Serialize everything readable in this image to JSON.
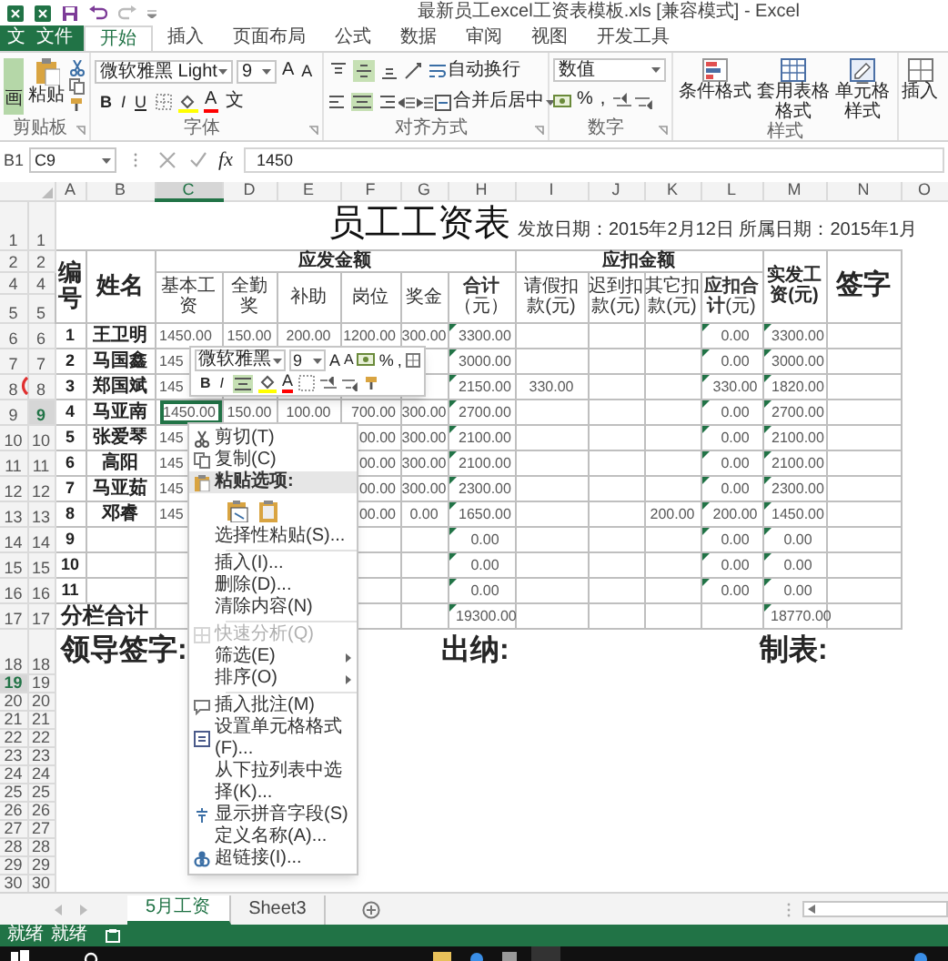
{
  "title_bar": {
    "title": "最新员工excel工资表模板.xls [兼容模式] - Excel"
  },
  "file_area": {
    "app_label": "文",
    "file_tab": "文件"
  },
  "tabs": [
    {
      "label": "开始",
      "selected": true
    },
    {
      "label": "插入",
      "selected": false
    },
    {
      "label": "页面布局",
      "selected": false
    },
    {
      "label": "公式",
      "selected": false
    },
    {
      "label": "数据",
      "selected": false
    },
    {
      "label": "审阅",
      "selected": false
    },
    {
      "label": "视图",
      "selected": false
    },
    {
      "label": "开发工具",
      "selected": false
    }
  ],
  "ribbon": {
    "clipboard": {
      "side_button": {
        "label": "画",
        "selected": true
      },
      "paste": "粘贴",
      "group": "剪贴板"
    },
    "font": {
      "font_name": "微软雅黑 Light",
      "font_size": "9",
      "grow": "A",
      "shrink": "A",
      "bold": "B",
      "italic": "I",
      "underline": "U",
      "font_color": "A",
      "phonetic": "文",
      "group": "字体"
    },
    "alignment": {
      "vertical_buttons": [
        {
          "selected": false
        },
        {
          "selected": true
        },
        {
          "selected": false
        }
      ],
      "horizontal_buttons": [
        {
          "selected": false
        },
        {
          "selected": true
        },
        {
          "selected": false
        }
      ],
      "wrap": "自动换行",
      "merge": "合并后居中",
      "group": "对齐方式"
    },
    "number": {
      "format": "数值",
      "percent": "%",
      "comma": ",",
      "group": "数字"
    },
    "styles": {
      "conditional": "条件格式",
      "table": "套用表格格式",
      "cell": "单元格样式",
      "group": "样式"
    },
    "cells": {
      "insert": "插入"
    }
  },
  "formula_bar": {
    "cell_ref": "B1",
    "name_box": "C9",
    "function_label": "fx",
    "formula": "1450"
  },
  "columns": [
    {
      "label": "A",
      "selected": false
    },
    {
      "label": "B",
      "selected": false
    },
    {
      "label": "C",
      "selected": true
    },
    {
      "label": "D",
      "selected": false
    },
    {
      "label": "E",
      "selected": false
    },
    {
      "label": "F",
      "selected": false
    },
    {
      "label": "G",
      "selected": false
    },
    {
      "label": "H",
      "selected": false
    },
    {
      "label": "I",
      "selected": false
    },
    {
      "label": "J",
      "selected": false
    },
    {
      "label": "K",
      "selected": false
    },
    {
      "label": "L",
      "selected": false
    },
    {
      "label": "M",
      "selected": false
    },
    {
      "label": "N",
      "selected": false
    },
    {
      "label": "O",
      "selected": false
    }
  ],
  "sheet": {
    "title": "员工工资表",
    "dates": "发放日期：2015年2月12日 所属日期：2015年1月"
  },
  "sheet_rows": [
    {
      "kind": "title",
      "row_headers": [
        {
          "label": "1",
          "selected": false
        },
        {
          "label": "1",
          "selected": false
        }
      ]
    },
    {
      "kind": "group_header",
      "row_headers": [
        {
          "label": "2",
          "selected": false
        },
        {
          "label": "2",
          "selected": false
        }
      ],
      "cells": {
        "A": "编号",
        "B": "姓名",
        "C": "应发金额",
        "I": "应扣金额",
        "M": "实发工资(元)",
        "N": "签字"
      }
    },
    {
      "kind": "column_header",
      "row_headers": [
        {
          "label": "4",
          "selected": false
        },
        {
          "label": "4",
          "selected": false
        }
      ],
      "cells": {
        "C": "基本工资",
        "D": "全勤奖",
        "E": "补助",
        "F": "岗位",
        "G": "奖金",
        "H": "**合计**（元）",
        "I": "请假扣款(元)",
        "J": "迟到扣款(元)",
        "K": "其它扣款(元)",
        "L": "**应扣合计**(元)"
      }
    },
    {
      "kind": "header_end",
      "row_headers": [
        {
          "label": "5",
          "selected": false
        },
        {
          "label": "5",
          "selected": false
        }
      ]
    },
    {
      "kind": "data",
      "flagged": true,
      "row_headers": [
        {
          "label": "6",
          "selected": false
        },
        {
          "label": "6",
          "selected": false
        }
      ],
      "cells": {
        "A": "1",
        "B": "王卫明",
        "C": "1450.00",
        "D": "150.00",
        "E": "200.00",
        "F": "1200.00",
        "G": "300.00",
        "H": "3300.00",
        "L": "0.00",
        "M": "3300.00"
      }
    },
    {
      "kind": "data",
      "flagged": true,
      "row_headers": [
        {
          "label": "7",
          "selected": false
        },
        {
          "label": "7",
          "selected": false
        }
      ],
      "cells": {
        "A": "2",
        "B": "马国鑫",
        "C": "145",
        "H": "3000.00",
        "L": "0.00",
        "M": "3000.00"
      }
    },
    {
      "kind": "data",
      "flagged": true,
      "row_headers": [
        {
          "label": "8",
          "selected": false
        },
        {
          "label": "8",
          "selected": false
        }
      ],
      "cells": {
        "A": "3",
        "B": "郑国斌",
        "C": "145",
        "H": "2150.00",
        "I": "330.00",
        "L": "330.00",
        "M": "1820.00"
      }
    },
    {
      "kind": "data",
      "flagged": true,
      "row_headers": [
        {
          "label": "9",
          "selected": false
        },
        {
          "label": "9",
          "selected": true
        }
      ],
      "cells": {
        "A": "4",
        "B": "马亚南",
        "C": {
          "text": "1450.00",
          "selected": true
        },
        "D": "150.00",
        "E": "100.00",
        "F": "700.00",
        "G": "300.00",
        "H": "2700.00",
        "L": "0.00",
        "M": "2700.00"
      }
    },
    {
      "kind": "data",
      "flagged": true,
      "row_headers": [
        {
          "label": "10",
          "selected": false
        },
        {
          "label": "10",
          "selected": false
        }
      ],
      "cells": {
        "A": "5",
        "B": "张爱琴",
        "C": "145",
        "F": "00.00",
        "G": "300.00",
        "H": "2100.00",
        "L": "0.00",
        "M": "2100.00"
      }
    },
    {
      "kind": "data",
      "flagged": true,
      "row_headers": [
        {
          "label": "11",
          "selected": false
        },
        {
          "label": "11",
          "selected": false
        }
      ],
      "cells": {
        "A": "6",
        "B": "高阳",
        "C": "145",
        "F": "00.00",
        "G": "300.00",
        "H": "2100.00",
        "L": "0.00",
        "M": "2100.00"
      }
    },
    {
      "kind": "data",
      "flagged": true,
      "row_headers": [
        {
          "label": "12",
          "selected": false
        },
        {
          "label": "12",
          "selected": false
        }
      ],
      "cells": {
        "A": "7",
        "B": "马亚茹",
        "C": "145",
        "F": "00.00",
        "G": "300.00",
        "H": "2300.00",
        "L": "0.00",
        "M": "2300.00"
      }
    },
    {
      "kind": "data",
      "flagged": true,
      "row_headers": [
        {
          "label": "13",
          "selected": false
        },
        {
          "label": "13",
          "selected": false
        }
      ],
      "cells": {
        "A": "8",
        "B": "邓睿",
        "C": "145",
        "F": "00.00",
        "G": "0.00",
        "H": "1650.00",
        "K": "200.00",
        "L": "200.00",
        "M": "1450.00"
      }
    },
    {
      "kind": "data",
      "flagged": true,
      "row_headers": [
        {
          "label": "14",
          "selected": false
        },
        {
          "label": "14",
          "selected": false
        }
      ],
      "cells": {
        "A": "9",
        "H": "0.00",
        "L": "0.00",
        "M": "0.00"
      }
    },
    {
      "kind": "data",
      "flagged": true,
      "row_headers": [
        {
          "label": "15",
          "selected": false
        },
        {
          "label": "15",
          "selected": false
        }
      ],
      "cells": {
        "A": "10",
        "H": "0.00",
        "L": "0.00",
        "M": "0.00"
      }
    },
    {
      "kind": "data",
      "flagged": true,
      "row_headers": [
        {
          "label": "16",
          "selected": false
        },
        {
          "label": "16",
          "selected": false
        }
      ],
      "cells": {
        "A": "11",
        "H": "0.00",
        "L": "0.00",
        "M": "0.00"
      }
    },
    {
      "kind": "total",
      "flagged": true,
      "row_headers": [
        {
          "label": "17",
          "selected": false
        },
        {
          "label": "17",
          "selected": false
        }
      ],
      "cells": {
        "A": "分栏合计",
        "H": "19300.00",
        "M": "18770.00"
      }
    },
    {
      "kind": "signature",
      "row_headers": [
        {
          "label": "18",
          "selected": false
        },
        {
          "label": "18",
          "selected": false
        }
      ],
      "texts": [
        "领导签字:",
        "出纳:",
        "制表:"
      ]
    },
    {
      "kind": "blank",
      "row_headers": [
        {
          "label": "19",
          "selected": true
        },
        {
          "label": "19",
          "selected": false
        }
      ]
    },
    {
      "kind": "blank",
      "row_headers": [
        {
          "label": "20",
          "selected": false
        },
        {
          "label": "20",
          "selected": false
        }
      ]
    },
    {
      "kind": "blank",
      "row_headers": [
        {
          "label": "21",
          "selected": false
        },
        {
          "label": "21",
          "selected": false
        }
      ]
    },
    {
      "kind": "blank",
      "row_headers": [
        {
          "label": "22",
          "selected": false
        },
        {
          "label": "22",
          "selected": false
        }
      ]
    },
    {
      "kind": "blank",
      "row_headers": [
        {
          "label": "23",
          "selected": false
        },
        {
          "label": "23",
          "selected": false
        }
      ]
    },
    {
      "kind": "blank",
      "row_headers": [
        {
          "label": "24",
          "selected": false
        },
        {
          "label": "24",
          "selected": false
        }
      ]
    },
    {
      "kind": "blank",
      "row_headers": [
        {
          "label": "25",
          "selected": false
        },
        {
          "label": "25",
          "selected": false
        }
      ]
    },
    {
      "kind": "blank",
      "row_headers": [
        {
          "label": "26",
          "selected": false
        },
        {
          "label": "26",
          "selected": false
        }
      ]
    },
    {
      "kind": "blank",
      "row_headers": [
        {
          "label": "27",
          "selected": false
        },
        {
          "label": "27",
          "selected": false
        }
      ]
    },
    {
      "kind": "blank",
      "row_headers": [
        {
          "label": "28",
          "selected": false
        },
        {
          "label": "28",
          "selected": false
        }
      ]
    },
    {
      "kind": "blank",
      "row_headers": [
        {
          "label": "29",
          "selected": false
        },
        {
          "label": "29",
          "selected": false
        }
      ]
    },
    {
      "kind": "blank",
      "row_headers": [
        {
          "label": "30",
          "selected": false
        },
        {
          "label": "30",
          "selected": false
        }
      ]
    }
  ],
  "mini_toolbar": {
    "font_name": "微软雅黑",
    "font_size": "9",
    "grow": "A",
    "shrink": "A",
    "percent": "%",
    "comma": ",",
    "bold": "B",
    "italic": "I",
    "font_color": "A",
    "center_align": {
      "selected": true
    }
  },
  "context_menu": {
    "items": [
      {
        "kind": "item",
        "label": "剪切(T)",
        "disabled": false,
        "highlighted": false,
        "submenu": false
      },
      {
        "kind": "item",
        "label": "复制(C)",
        "disabled": false,
        "highlighted": false,
        "submenu": false
      },
      {
        "kind": "heading",
        "label": "粘贴选项:",
        "disabled": false,
        "highlighted": true,
        "submenu": false
      },
      {
        "kind": "paste_options"
      },
      {
        "kind": "item",
        "label": "选择性粘贴(S)...",
        "disabled": false,
        "highlighted": false,
        "submenu": false
      },
      {
        "kind": "separator"
      },
      {
        "kind": "item",
        "label": "插入(I)...",
        "disabled": false,
        "highlighted": false,
        "submenu": false
      },
      {
        "kind": "item",
        "label": "删除(D)...",
        "disabled": false,
        "highlighted": false,
        "submenu": false
      },
      {
        "kind": "item",
        "label": "清除内容(N)",
        "disabled": false,
        "highlighted": false,
        "submenu": false
      },
      {
        "kind": "separator"
      },
      {
        "kind": "item",
        "label": "快速分析(Q)",
        "disabled": true,
        "highlighted": false,
        "submenu": false
      },
      {
        "kind": "item",
        "label": "筛选(E)",
        "disabled": false,
        "highlighted": false,
        "submenu": true
      },
      {
        "kind": "item",
        "label": "排序(O)",
        "disabled": false,
        "highlighted": false,
        "submenu": true
      },
      {
        "kind": "separator"
      },
      {
        "kind": "item",
        "label": "插入批注(M)",
        "disabled": false,
        "highlighted": false,
        "submenu": false
      },
      {
        "kind": "item",
        "label": "设置单元格格式(F)...",
        "disabled": false,
        "highlighted": false,
        "submenu": false
      },
      {
        "kind": "item",
        "label": "从下拉列表中选择(K)...",
        "disabled": false,
        "highlighted": false,
        "submenu": false
      },
      {
        "kind": "item",
        "label": "显示拼音字段(S)",
        "disabled": false,
        "highlighted": false,
        "submenu": false
      },
      {
        "kind": "item",
        "label": "定义名称(A)...",
        "disabled": false,
        "highlighted": false,
        "submenu": false
      },
      {
        "kind": "item",
        "label": "超链接(I)...",
        "disabled": false,
        "highlighted": false,
        "submenu": false
      }
    ]
  },
  "sheet_tabs": [
    {
      "label": "5月工资",
      "selected": true
    },
    {
      "label": "Sheet3",
      "selected": false
    }
  ],
  "status_bar": [
    "就绪",
    "就绪"
  ]
}
